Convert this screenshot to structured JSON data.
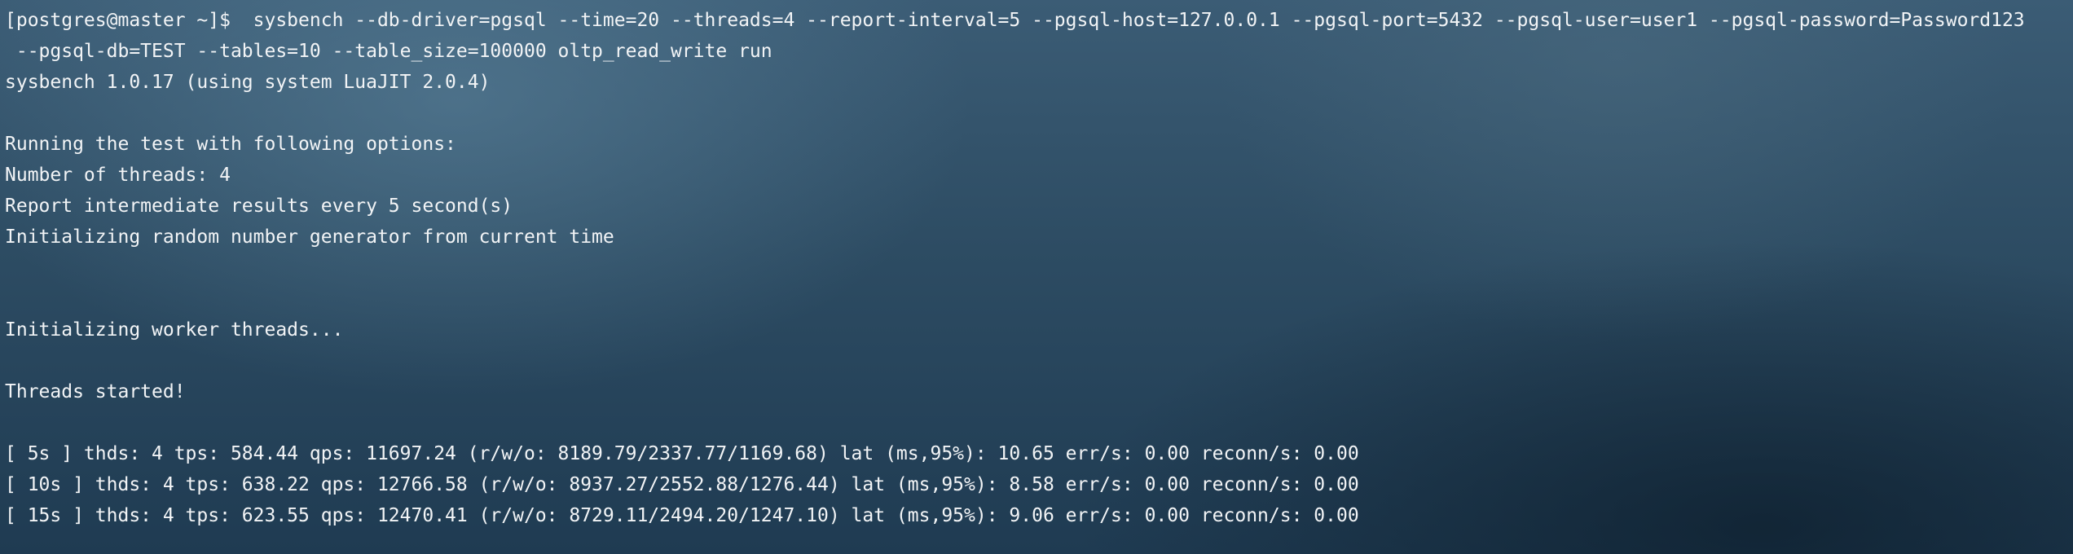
{
  "terminal": {
    "prompt": "[postgres@master ~]$ ",
    "command_line1": " sysbench --db-driver=pgsql --time=20 --threads=4 --report-interval=5 --pgsql-host=127.0.0.1 --pgsql-port=5432 --pgsql-user=user1 --pgsql-password=Password123",
    "command_line2": " --pgsql-db=TEST --tables=10 --table_size=100000 oltp_read_write run",
    "version": "sysbench 1.0.17 (using system LuaJIT 2.0.4)",
    "options_header": "Running the test with following options:",
    "threads": "Number of threads: 4",
    "report_interval": "Report intermediate results every 5 second(s)",
    "rng_init": "Initializing random number generator from current time",
    "worker_init": "Initializing worker threads...",
    "threads_started": "Threads started!",
    "results": [
      "[ 5s ] thds: 4 tps: 584.44 qps: 11697.24 (r/w/o: 8189.79/2337.77/1169.68) lat (ms,95%): 10.65 err/s: 0.00 reconn/s: 0.00",
      "[ 10s ] thds: 4 tps: 638.22 qps: 12766.58 (r/w/o: 8937.27/2552.88/1276.44) lat (ms,95%): 8.58 err/s: 0.00 reconn/s: 0.00",
      "[ 15s ] thds: 4 tps: 623.55 qps: 12470.41 (r/w/o: 8729.11/2494.20/1247.10) lat (ms,95%): 9.06 err/s: 0.00 reconn/s: 0.00"
    ]
  }
}
